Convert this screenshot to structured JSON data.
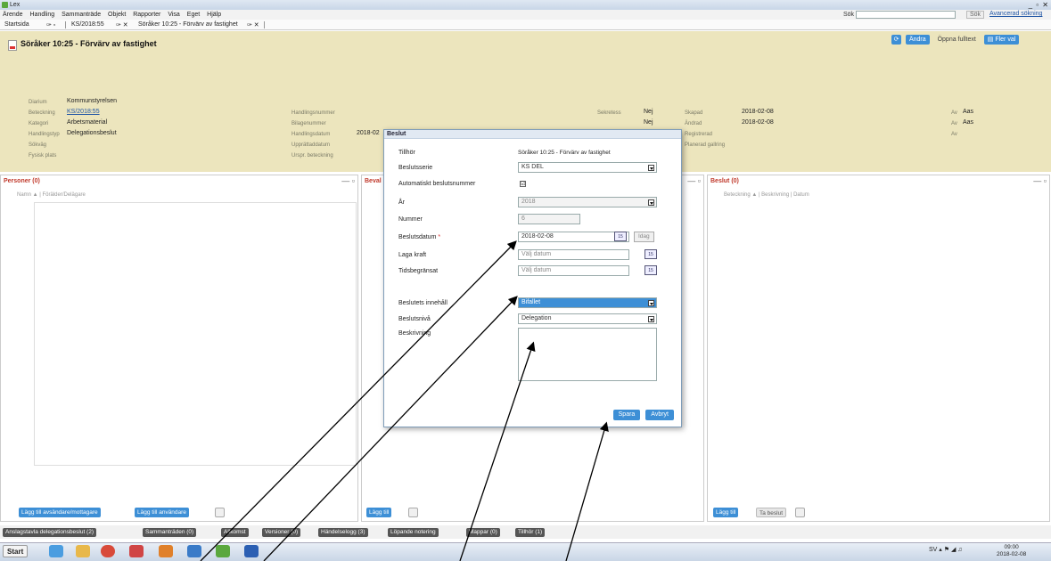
{
  "window": {
    "title": "Lex",
    "controls": "_ ▫ ✕"
  },
  "menu": [
    "Ärende",
    "Handling",
    "Sammanträde",
    "Objekt",
    "Rapporter",
    "Visa",
    "Eget",
    "Hjälp"
  ],
  "search": {
    "label": "Sök",
    "button": "Sök",
    "advanced": "Avancerad sökning"
  },
  "tabs": [
    {
      "label": "Startsida"
    },
    {
      "label": "KS/2018:55"
    },
    {
      "label": "Söråker 10:25 - Förvärv av fastighet"
    }
  ],
  "header": {
    "title": "Söråker 10:25 - Förvärv av fastighet",
    "buttons": {
      "change": "Ändra",
      "open_full": "Öppna fulltext",
      "more": "Fler val"
    },
    "fields": {
      "diarium": {
        "label": "Diarium",
        "value": "Kommunstyrelsen"
      },
      "beteckning": {
        "label": "Beteckning",
        "value": "KS/2018:55"
      },
      "kategori": {
        "label": "Kategori",
        "value": "Arbetsmaterial"
      },
      "handlingstyp": {
        "label": "Handlingstyp",
        "value": "Delegationsbeslut"
      },
      "sokvag": {
        "label": "Sökväg",
        "value": ""
      },
      "fysisk_plats": {
        "label": "Fysisk plats",
        "value": ""
      },
      "handlingsnummer": {
        "label": "Handlingsnummer",
        "value": ""
      },
      "bilagenummer": {
        "label": "Bilagenummer",
        "value": ""
      },
      "handlingsdatum": {
        "label": "Handlingsdatum",
        "value": "2018-02"
      },
      "upprattaddatum": {
        "label": "Upprättaddatum",
        "value": ""
      },
      "urspr_beteckning": {
        "label": "Urspr. beteckning",
        "value": ""
      },
      "sekretess": {
        "label": "Sekretess",
        "value": "Nej"
      },
      "sekretess2": {
        "label": "",
        "value": "Nej"
      },
      "skapad": {
        "label": "Skapad",
        "value": "2018-02-08"
      },
      "andrad": {
        "label": "Ändrad",
        "value": "2018-02-08"
      },
      "registrerad": {
        "label": "Registrerad",
        "value": ""
      },
      "planerad_gallring": {
        "label": "Planerad gallring",
        "value": ""
      },
      "av1": {
        "label": "Av",
        "value": "Aas"
      },
      "av2": {
        "label": "Av",
        "value": "Aas"
      },
      "av3": {
        "label": "Av",
        "value": ""
      }
    }
  },
  "panels": {
    "personer": {
      "title": "Personer (0)",
      "columns": "Namn ▲  |  Förälder/Delägare",
      "buttons": [
        "Lägg till avsändare/mottagare",
        "Lägg till användare"
      ]
    },
    "middle": {
      "title": "Beval",
      "buttons": [
        "Lägg till"
      ]
    },
    "beslut": {
      "title": "Beslut (0)",
      "columns": "Beteckning ▲  |  Beskrivning  |  Datum",
      "buttons": [
        "Lägg till",
        "Ta beslut"
      ]
    }
  },
  "bottom_tabs": [
    "Anslagstavla delegationsbeslut (2)",
    "Sammanträden (0)",
    "Allkomst",
    "Versioner (0)",
    "Händelselogg (3)",
    "Löpande notering",
    "Mappar (0)",
    "Tillhör (1)"
  ],
  "taskbar": {
    "start": "Start",
    "lang": "SV",
    "time": "09:00",
    "date": "2018-02-08"
  },
  "dialog": {
    "title": "Beslut",
    "fields": {
      "tillhor": {
        "label": "Tillhör",
        "value": "Söråker 10:25 - Förvärv av fastighet"
      },
      "beslutsserie": {
        "label": "Beslutsserie",
        "value": "KS DEL"
      },
      "auto_nr": {
        "label": "Automatiskt beslutsnummer",
        "value": "☑"
      },
      "ar": {
        "label": "År",
        "value": "2018"
      },
      "nummer": {
        "label": "Nummer",
        "value": "6"
      },
      "beslutsdatum": {
        "label": "Beslutsdatum",
        "required": "*",
        "value": "2018-02-08"
      },
      "laga_kraft": {
        "label": "Laga kraft",
        "value": "Välj datum"
      },
      "tidsbegransat": {
        "label": "Tidsbegränsat",
        "value": "Välj datum"
      },
      "innehall": {
        "label": "Beslutets innehåll",
        "value": "Bifallet"
      },
      "beslutsniva": {
        "label": "Beslutsnivå",
        "value": "Delegation"
      },
      "beskrivning": {
        "label": "Beskrivning",
        "value": ""
      }
    },
    "today": "Idag",
    "cal_day": "15",
    "buttons": {
      "save": "Spara",
      "cancel": "Avbryt"
    }
  }
}
